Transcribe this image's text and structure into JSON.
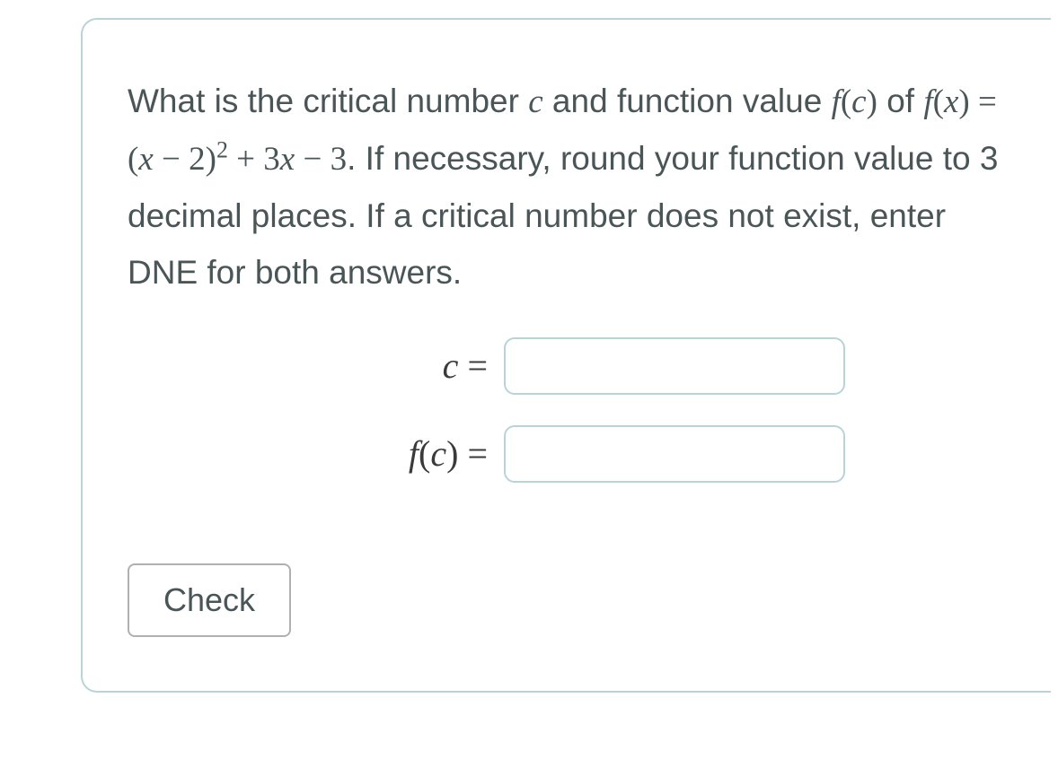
{
  "question": {
    "intro": "What is the critical number ",
    "var_c": "c",
    "mid1": " and function value ",
    "fc": "f(c)",
    "mid2": " of ",
    "fx_expr_prefix": "f(x) = (x − 2)",
    "fx_expr_exp": "2",
    "fx_expr_suffix": " + 3x − 3",
    "after_expr": ". If necessary, round your function value to 3 decimal places. If a critical number does not exist, enter DNE for both answers."
  },
  "inputs": {
    "c_label_var": "c",
    "c_label_eq": " =",
    "c_value": "",
    "fc_label_func": "f",
    "fc_label_arg": "(c)",
    "fc_label_eq": " =",
    "fc_value": ""
  },
  "buttons": {
    "check": "Check"
  }
}
